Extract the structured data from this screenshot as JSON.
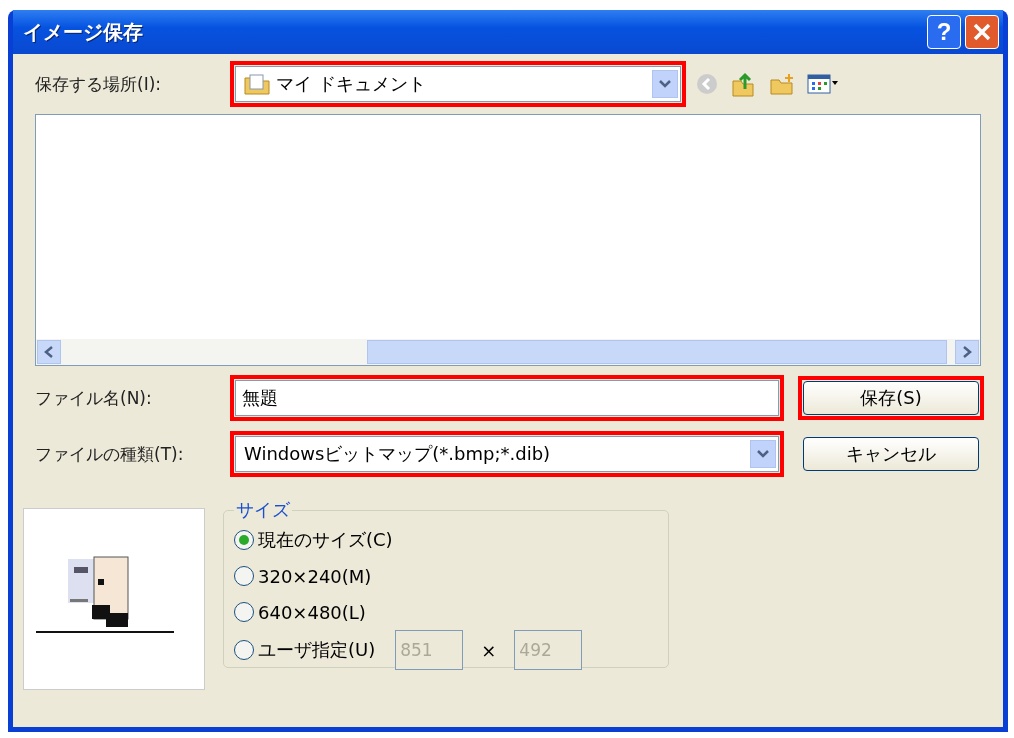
{
  "window": {
    "title": "イメージ保存",
    "help_button": "?"
  },
  "location": {
    "label": "保存する場所(I):",
    "value": "マイ ドキュメント",
    "highlighted": true
  },
  "file_name": {
    "label": "ファイル名(N):",
    "value": "無題",
    "highlighted": true
  },
  "file_type": {
    "label": "ファイルの種類(T):",
    "value": "Windowsビットマップ(*.bmp;*.dib)",
    "highlighted": true
  },
  "buttons": [
    {
      "label": "保存(S)",
      "highlighted": true
    },
    {
      "label": "キャンセル",
      "highlighted": false
    }
  ],
  "size_group": {
    "title": "サイズ",
    "options": [
      {
        "label": "現在のサイズ(C)",
        "selected": true
      },
      {
        "label": "320×240(M)",
        "selected": false
      },
      {
        "label": "640×480(L)",
        "selected": false
      },
      {
        "label": "ユーザ指定(U)",
        "selected": false
      }
    ],
    "width": {
      "value": "851",
      "disabled": true
    },
    "separator": "×",
    "height": {
      "value": "492",
      "disabled": true
    }
  }
}
